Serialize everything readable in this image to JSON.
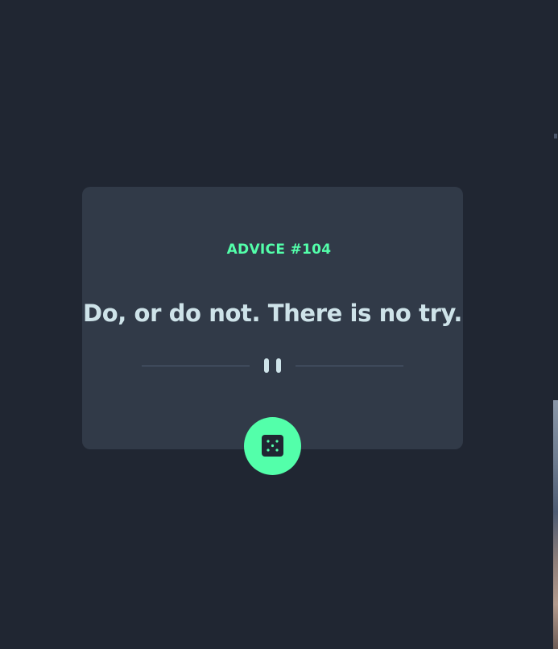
{
  "advice": {
    "id_label": "ADVICE #104",
    "text": "Do, or do not. There is no try."
  },
  "icons": {
    "divider": "pause-icon",
    "button": "dice-icon"
  },
  "colors": {
    "background": "#202632",
    "card": "#313a48",
    "accent": "#53ffaa",
    "text": "#cee3e9",
    "divider": "#4f5d74"
  }
}
